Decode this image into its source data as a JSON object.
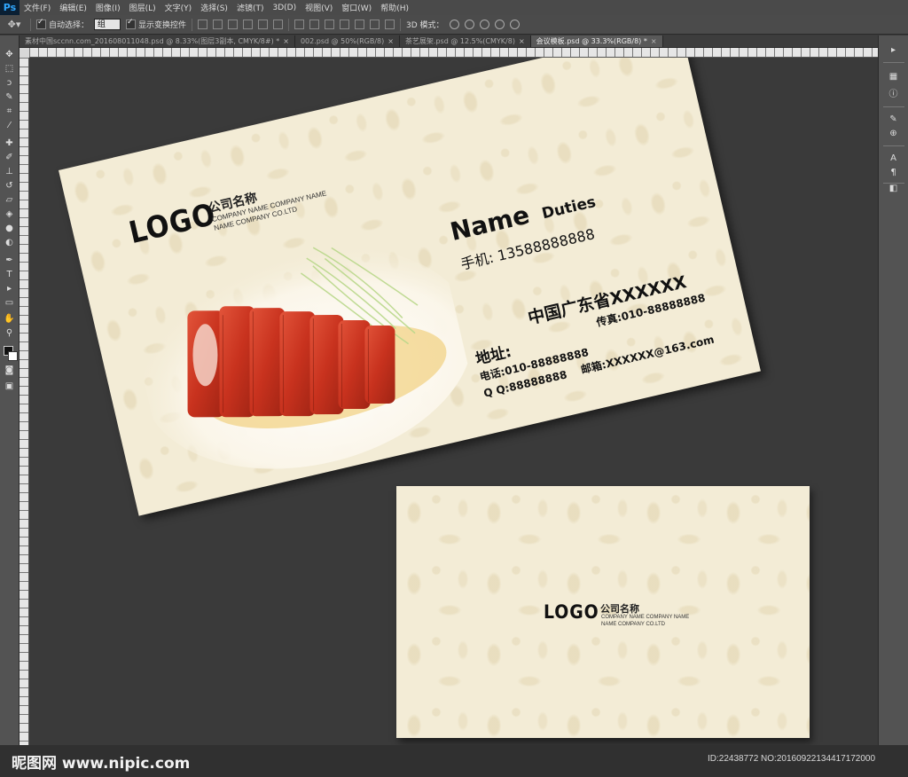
{
  "app": {
    "logo": "Ps"
  },
  "menu": [
    "文件(F)",
    "编辑(E)",
    "图像(I)",
    "图层(L)",
    "文字(Y)",
    "选择(S)",
    "滤镜(T)",
    "3D(D)",
    "视图(V)",
    "窗口(W)",
    "帮助(H)"
  ],
  "options": {
    "tool_icon": "move-tool-icon",
    "auto_select_label": "自动选择：",
    "auto_select_value": "组",
    "show_transform_label": "显示变换控件",
    "mode3d_label": "3D 模式："
  },
  "tabs": [
    {
      "label": "素材中国sccnn.com_201608011048.psd @ 8.33%(图层3副本, CMYK/8#) *",
      "active": false
    },
    {
      "label": "002.psd @ 50%(RGB/8)",
      "active": false
    },
    {
      "label": "茶艺展架.psd @ 12.5%(CMYK/8)",
      "active": false
    },
    {
      "label": "会议模板.psd @ 33.3%(RGB/8) *",
      "active": true
    }
  ],
  "card_front": {
    "logo": "LOGO",
    "company_cn": "公司名称",
    "company_en_1": "COMPANY NAME COMPANY NAME",
    "company_en_2": "NAME COMPANY CO.LTD",
    "name": "Name",
    "duties": "Duties",
    "mobile": "手机:  13588888888",
    "province": "中国广东省XXXXXX",
    "address_label": "地址:",
    "fax": "传真:010-88888888",
    "phone": "电话:010-88888888",
    "qq": "Q Q:88888888",
    "email": "邮箱:XXXXXX@163.com"
  },
  "card_back": {
    "logo": "LOGO",
    "company_cn": "公司名称",
    "company_en_1": "COMPANY NAME COMPANY NAME",
    "company_en_2": "NAME COMPANY CO.LTD"
  },
  "watermark": {
    "left": "昵图网 www.nipic.com",
    "right": "ID:22438772 NO:20160922134417172000"
  },
  "colors": {
    "ps_blue": "#31a8ff",
    "card_bg": "#f3ecd6",
    "meat": "#c8321e"
  }
}
